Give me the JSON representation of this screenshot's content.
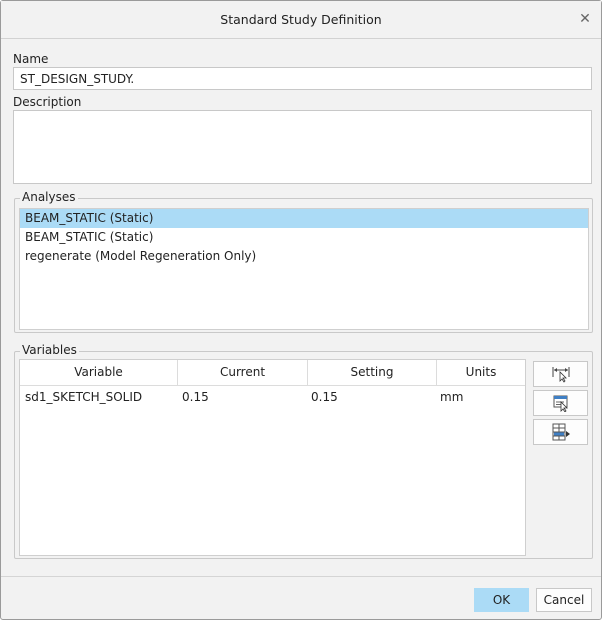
{
  "dialog": {
    "title": "Standard Study Definition",
    "close_icon": "close-icon"
  },
  "name": {
    "label": "Name",
    "value": "ST_DESIGN_STUDY."
  },
  "description": {
    "label": "Description",
    "value": ""
  },
  "analyses": {
    "label": "Analyses",
    "items": [
      {
        "label": "BEAM_STATIC (Static)",
        "selected": true
      },
      {
        "label": "BEAM_STATIC (Static)",
        "selected": false
      },
      {
        "label": "regenerate (Model Regeneration Only)",
        "selected": false
      }
    ]
  },
  "variables": {
    "label": "Variables",
    "columns": [
      "Variable",
      "Current",
      "Setting",
      "Units"
    ],
    "rows": [
      {
        "variable": "sd1_SKETCH_SOLID",
        "current": "0.15",
        "setting": "0.15",
        "units": "mm"
      }
    ],
    "tools": [
      {
        "icon": "select-dimension-icon"
      },
      {
        "icon": "select-parameter-icon"
      },
      {
        "icon": "add-row-icon"
      }
    ]
  },
  "buttons": {
    "ok": "OK",
    "cancel": "Cancel"
  },
  "colors": {
    "selection": "#abdbf6",
    "dialog_bg": "#f2f2f2"
  }
}
